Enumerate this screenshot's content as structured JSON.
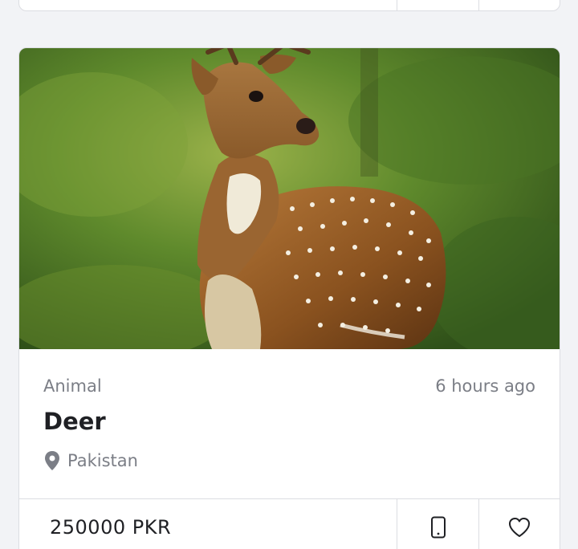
{
  "listing": {
    "photo_alt": "Deer",
    "category": "Animal",
    "posted": "6 hours ago",
    "title": "Deer",
    "location": "Pakistan",
    "price": "250000 PKR"
  },
  "icons": {
    "location": "map-pin-icon",
    "call": "mobile-phone-icon",
    "favorite": "heart-icon"
  },
  "colors": {
    "background": "#f2f3f6",
    "card": "#ffffff",
    "border": "#dcdde2",
    "text_primary": "#1f2024",
    "text_secondary": "#7b7e86"
  }
}
